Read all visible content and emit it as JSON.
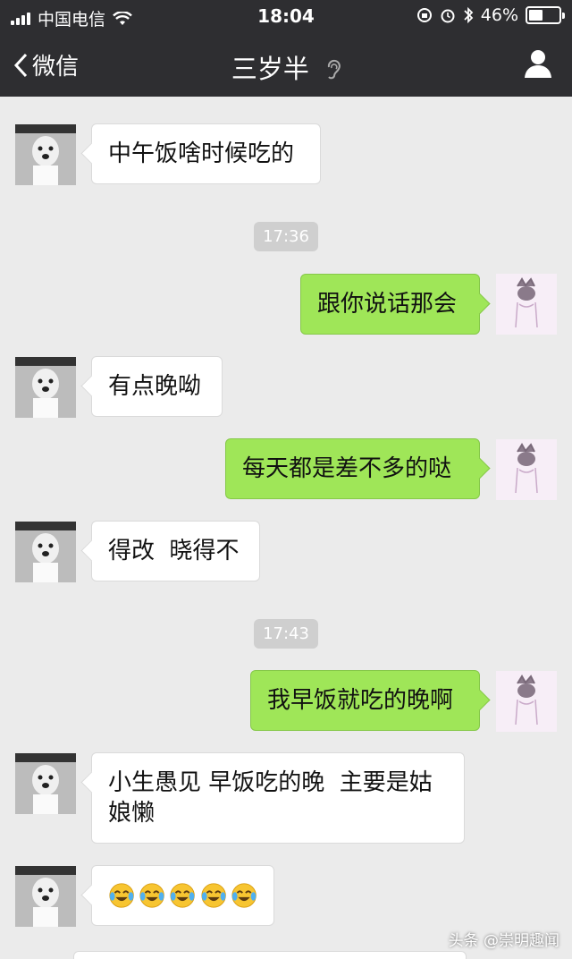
{
  "status": {
    "carrier": "中国电信",
    "time": "18:04",
    "battery": "46%",
    "battery_level": 0.46
  },
  "nav": {
    "back_label": "微信",
    "title": "三岁半"
  },
  "timestamps": [
    "17:36",
    "17:43"
  ],
  "messages": [
    {
      "from": "friend",
      "text": "中午饭啥时候吃的"
    },
    {
      "from": "me",
      "text": "跟你说话那会"
    },
    {
      "from": "friend",
      "text": "有点晚呦"
    },
    {
      "from": "me",
      "text": "每天都是差不多的哒"
    },
    {
      "from": "friend",
      "text": "得改  晓得不"
    },
    {
      "from": "me",
      "text": "我早饭就吃的晚啊"
    },
    {
      "from": "friend",
      "text": "小生愚见 早饭吃的晚  主要是姑娘懒"
    },
    {
      "from": "friend",
      "text": "",
      "emoji": [
        "laughing-crying",
        "laughing-crying",
        "laughing-crying",
        "laughing-crying",
        "laughing-crying"
      ]
    }
  ],
  "watermark": "头条 @崇明趣闻",
  "icons": {
    "back": "chevron-left-icon",
    "ear": "ear-icon",
    "profile": "person-icon",
    "wifi": "wifi-icon",
    "alarm": "alarm-icon",
    "bluetooth": "bluetooth-icon"
  },
  "colors": {
    "bar": "#2e2e31",
    "background": "#ebebeb",
    "bubble_out": "#9fe658",
    "bubble_in": "#ffffff"
  }
}
